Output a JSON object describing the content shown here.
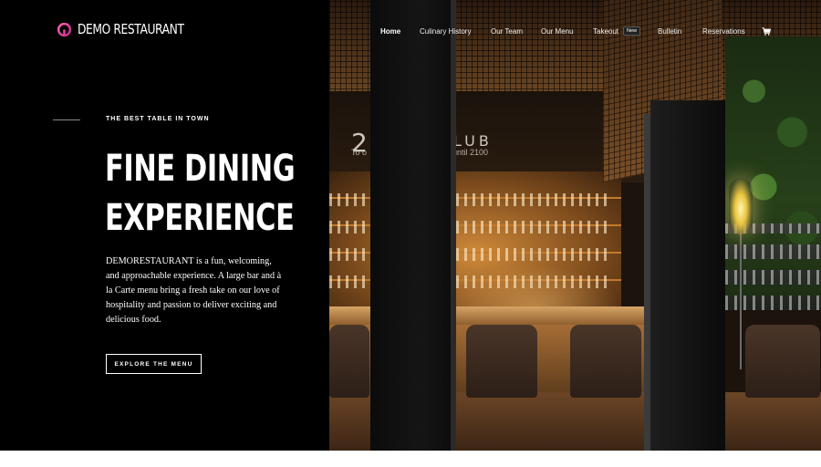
{
  "brand": {
    "name": "DEMO RESTAURANT",
    "icon": "logo-ring-icon",
    "accent_color": "#e83e9a"
  },
  "nav": {
    "items": [
      {
        "label": "Home",
        "active": true
      },
      {
        "label": "Culinary History",
        "active": false
      },
      {
        "label": "Our Team",
        "active": false
      },
      {
        "label": "Our Menu",
        "active": false
      },
      {
        "label": "Takeout",
        "active": false
      },
      {
        "label": "Bulletin",
        "active": false
      },
      {
        "label": "Reservations",
        "active": false
      }
    ],
    "takeout_badge": "New",
    "cart_icon": "cart-icon"
  },
  "hero": {
    "eyebrow": "THE BEST TABLE IN TOWN",
    "headline_line1": "FINE DINING",
    "headline_line2": "EXPERIENCE",
    "description": "DEMORESTAURANT is a fun, welcoming, and approachable experience. A large bar and à la Carte menu bring a fresh take on our love of hospitality and passion to deliver exciting and delicious food.",
    "cta_label": "EXPLORE THE MENU"
  },
  "photo": {
    "sign_number": "2",
    "sign_word": "LUB",
    "sign_sub_left": "To o",
    "sign_sub_right": "until 2100"
  },
  "colors": {
    "background": "#000000",
    "text": "#ffffff"
  }
}
